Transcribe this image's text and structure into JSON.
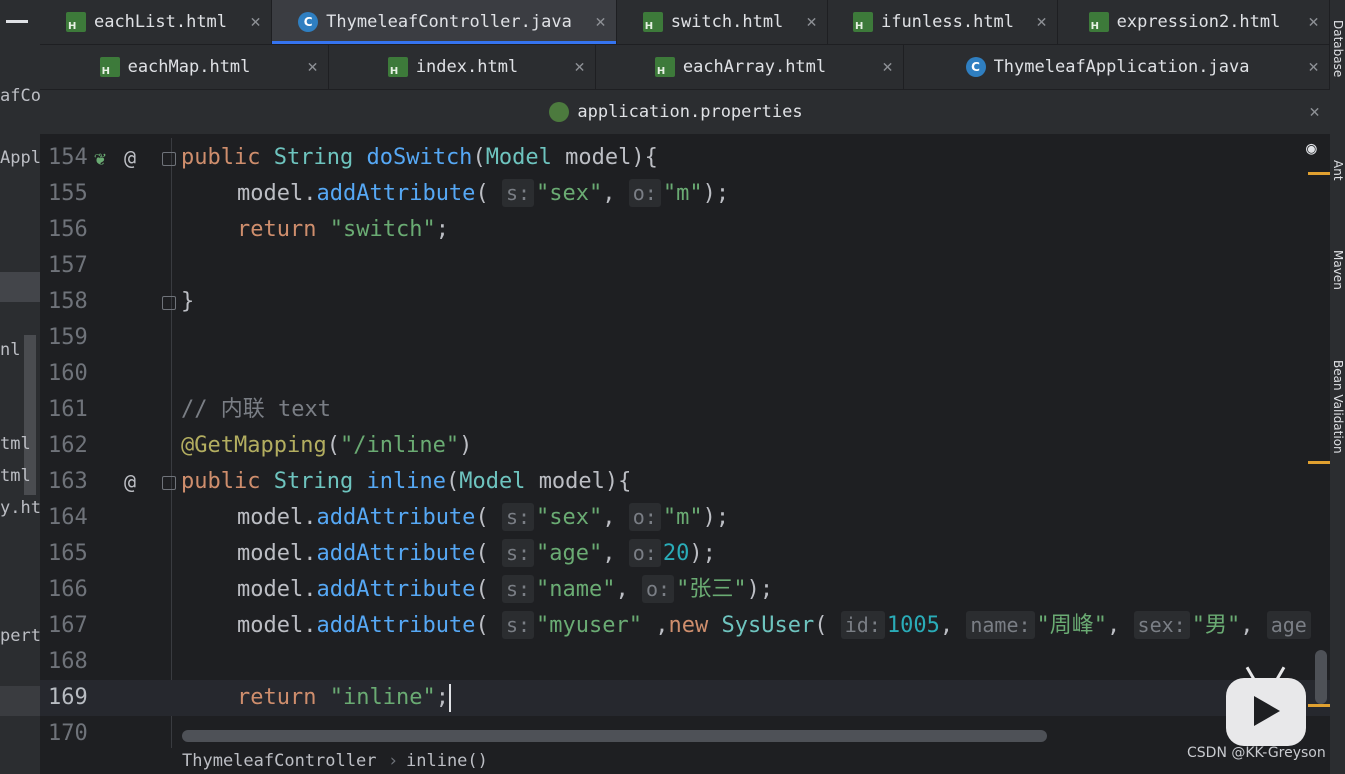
{
  "left_panel": {
    "fragments": [
      "afCo",
      "Appli",
      "nl",
      "tml",
      "tml",
      "y.htm",
      "pert"
    ]
  },
  "tabs": {
    "row1": [
      {
        "label": "eachList.html",
        "icon": "html-file-icon",
        "active": false
      },
      {
        "label": "ThymeleafController.java",
        "icon": "java-class-icon",
        "active": true
      },
      {
        "label": "switch.html",
        "icon": "html-file-icon",
        "active": false
      },
      {
        "label": "ifunless.html",
        "icon": "html-file-icon",
        "active": false
      },
      {
        "label": "expression2.html",
        "icon": "html-file-icon",
        "active": false
      }
    ],
    "row2": [
      {
        "label": "eachMap.html",
        "icon": "html-file-icon"
      },
      {
        "label": "index.html",
        "icon": "html-file-icon"
      },
      {
        "label": "eachArray.html",
        "icon": "html-file-icon"
      },
      {
        "label": "ThymeleafApplication.java",
        "icon": "spring-app-icon"
      }
    ],
    "row3": [
      {
        "label": "application.properties",
        "icon": "properties-file-icon"
      }
    ]
  },
  "editor": {
    "lines": [
      {
        "num": "154"
      },
      {
        "num": "155"
      },
      {
        "num": "156"
      },
      {
        "num": "157"
      },
      {
        "num": "158"
      },
      {
        "num": "159"
      },
      {
        "num": "160"
      },
      {
        "num": "161"
      },
      {
        "num": "162"
      },
      {
        "num": "163"
      },
      {
        "num": "164"
      },
      {
        "num": "165"
      },
      {
        "num": "166"
      },
      {
        "num": "167"
      },
      {
        "num": "168"
      },
      {
        "num": "169"
      },
      {
        "num": "170"
      }
    ],
    "tokens": {
      "public": "public",
      "string": "String",
      "doSwitch": "doSwitch",
      "model_type": "Model",
      "model": "model",
      "open_brace": "){",
      "paren_open": "(",
      "model_dot": "model.",
      "addAttribute": "addAttribute",
      "hint_s": "s:",
      "hint_o": "o:",
      "hint_id": "id:",
      "hint_name": "name:",
      "hint_sex": "sex:",
      "hint_age": "age",
      "str_sex": "\"sex\"",
      "str_m": "\"m\"",
      "str_age": "\"age\"",
      "str_name": "\"name\"",
      "str_zhangsan": "\"张三\"",
      "str_myuser": "\"myuser\"",
      "str_zhoufeng": "\"周峰\"",
      "str_nan": "\"男\"",
      "num_20": "20",
      "num_1005": "1005",
      "comma": ",",
      "comma_new": " ,",
      "new": "new",
      "sysuser": "SysUser",
      "close_stmt": ");",
      "return": "return",
      "str_switch": "\"switch\"",
      "str_inline": "\"inline\"",
      "semicolon": ";",
      "close_brace": "}",
      "comment": "// 内联 text",
      "annotation": "@GetMapping",
      "mapping_path": "\"/inline\"",
      "close_paren": ")",
      "inline_fn": "inline"
    }
  },
  "breadcrumb": {
    "class_name": "ThymeleafController",
    "separator": "›",
    "method": "inline()"
  },
  "right_panel": {
    "labels": [
      "Database",
      "Ant",
      "Maven",
      "Bean Validation"
    ]
  },
  "watermark": "CSDN @KK-Greyson",
  "colors": {
    "keyword": "#cf8e6d",
    "string": "#6aab73",
    "type": "#6ec4bf",
    "function": "#56a8f5",
    "annotation": "#b3ae60",
    "comment": "#7a7e85",
    "accent": "#3574f0"
  }
}
